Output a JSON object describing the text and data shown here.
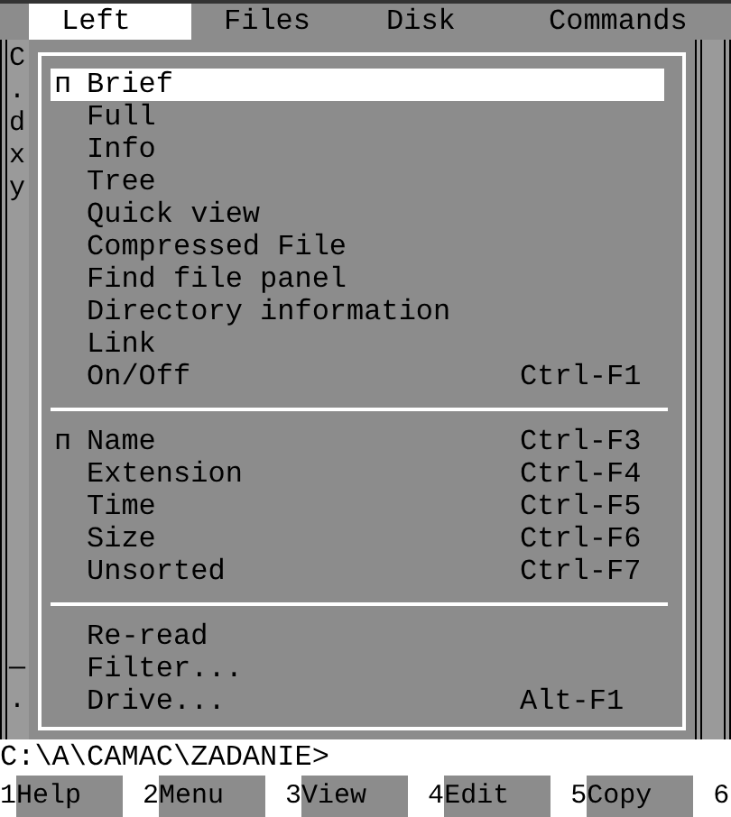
{
  "menu_bar": [
    {
      "label": "Left",
      "selected": true
    },
    {
      "label": "Files",
      "selected": false
    },
    {
      "label": "Disk",
      "selected": false
    },
    {
      "label": "Commands",
      "selected": false
    }
  ],
  "left_panel": {
    "top_lines": [
      "C",
      ".",
      "d",
      "x",
      "y"
    ],
    "bottom_lines": [
      "—",
      "."
    ]
  },
  "menu": {
    "items": [
      {
        "kind": "item",
        "check_glyph": "п",
        "label": "Brief",
        "selected": true
      },
      {
        "kind": "item",
        "label": "Full",
        "selected": false
      },
      {
        "kind": "item",
        "label": "Info",
        "selected": false
      },
      {
        "kind": "item",
        "label": "Tree",
        "selected": false
      },
      {
        "kind": "item",
        "label": "Quick view",
        "selected": false
      },
      {
        "kind": "item",
        "label": "Compressed File",
        "selected": false
      },
      {
        "kind": "item",
        "label": "Find file panel",
        "selected": false
      },
      {
        "kind": "item",
        "label": "Directory information",
        "selected": false
      },
      {
        "kind": "item",
        "label": "Link",
        "selected": false
      },
      {
        "kind": "item",
        "label": "On/Off",
        "shortcut": "Ctrl-F1",
        "selected": false
      },
      {
        "kind": "separator"
      },
      {
        "kind": "item",
        "check_glyph": "п",
        "label": "Name",
        "shortcut": "Ctrl-F3",
        "selected": false
      },
      {
        "kind": "item",
        "label": "Extension",
        "shortcut": "Ctrl-F4",
        "selected": false
      },
      {
        "kind": "item",
        "label": "Time",
        "shortcut": "Ctrl-F5",
        "selected": false
      },
      {
        "kind": "item",
        "label": "Size",
        "shortcut": "Ctrl-F6",
        "selected": false
      },
      {
        "kind": "item",
        "label": "Unsorted",
        "shortcut": "Ctrl-F7",
        "selected": false
      },
      {
        "kind": "separator"
      },
      {
        "kind": "item",
        "label": "Re-read",
        "selected": false
      },
      {
        "kind": "item",
        "label": "Filter...",
        "selected": false
      },
      {
        "kind": "item",
        "label": "Drive...",
        "shortcut": "Alt-F1",
        "selected": false
      }
    ]
  },
  "command_line": "C:\\A\\CAMAC\\ZADANIE>",
  "function_keys": [
    {
      "number": "1",
      "label": "Help"
    },
    {
      "number": "2",
      "label": "Menu"
    },
    {
      "number": "3",
      "label": "View"
    },
    {
      "number": "4",
      "label": "Edit"
    },
    {
      "number": "5",
      "label": "Copy"
    },
    {
      "number": "6"
    }
  ]
}
